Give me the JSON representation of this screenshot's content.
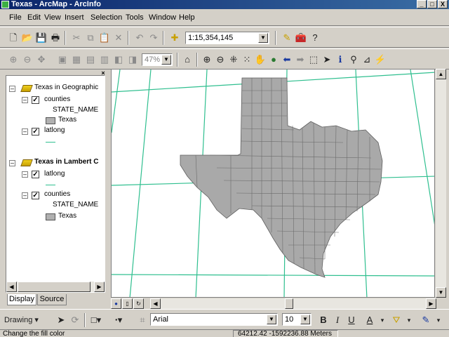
{
  "window": {
    "title": "Texas - ArcMap - ArcInfo",
    "min": "_",
    "max": "□",
    "close": "X"
  },
  "menu": [
    "File",
    "Edit",
    "View",
    "Insert",
    "Selection",
    "Tools",
    "Window",
    "Help"
  ],
  "standard_toolbar": {
    "scale": "1:15,354,145"
  },
  "tools_toolbar": {
    "zoom_percent": "47%"
  },
  "toc": {
    "frame1": {
      "name": "Texas in Geographic",
      "layers": [
        {
          "name": "counties",
          "field": "STATE_NAME",
          "legend": "Texas"
        },
        {
          "name": "latlong"
        }
      ]
    },
    "frame2": {
      "name": "Texas in Lambert C",
      "layers": [
        {
          "name": "latlong"
        },
        {
          "name": "counties",
          "field": "STATE_NAME",
          "legend": "Texas"
        }
      ]
    },
    "tabs": [
      "Display",
      "Source"
    ]
  },
  "drawing_toolbar": {
    "label": "Drawing",
    "font": "Arial",
    "size": "10",
    "bold": "B",
    "italic": "I",
    "underline": "U",
    "font_color": "A"
  },
  "status": {
    "message": "Change the fill color",
    "coords": "64212.42  -1592236.88 Meters"
  },
  "colors": {
    "graticule": "#2fbf8f",
    "texas_fill": "#a9a9a9",
    "title_bar": "#0a246a"
  }
}
